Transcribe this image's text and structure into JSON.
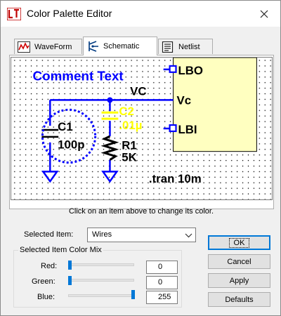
{
  "window": {
    "title": "Color Palette Editor"
  },
  "tabs": [
    {
      "label": "WaveForm",
      "active": false
    },
    {
      "label": "Schematic",
      "active": true
    },
    {
      "label": "Netlist",
      "active": false
    }
  ],
  "schematic": {
    "comment_text": "Comment Text",
    "net_vc": "VC",
    "pin_vc": "Vc",
    "pin_lbo": "LBO",
    "pin_lbi": "LBI",
    "c1_ref": "C1",
    "c1_value": "100p",
    "c2_ref": "C2",
    "c2_value": ".01µ",
    "r1_ref": "R1",
    "r1_value": "5K",
    "directive": ".tran 10m",
    "colors": {
      "background": "#ffffff",
      "grid": "#000000",
      "wires": "#0000ff",
      "component": "#000000",
      "comment": "#0000ff",
      "selected": "#ffff00",
      "symbol_fill": "#ffffc0",
      "pin": "#0000ff"
    }
  },
  "hint": "Click on an item above to change its color.",
  "selected_item": {
    "label": "Selected Item:",
    "value": "Wires"
  },
  "color_mix": {
    "title": "Selected Item Color Mix",
    "red": {
      "label": "Red:",
      "value": "0",
      "level": 0
    },
    "green": {
      "label": "Green:",
      "value": "0",
      "level": 0
    },
    "blue": {
      "label": "Blue:",
      "value": "255",
      "level": 255
    }
  },
  "buttons": {
    "ok": "OK",
    "cancel": "Cancel",
    "apply": "Apply",
    "defaults": "Defaults"
  },
  "icons": {
    "app": "ltspice-app-icon",
    "close": "close-icon",
    "waveform": "waveform-icon",
    "schematic": "schematic-icon",
    "netlist": "netlist-icon"
  }
}
